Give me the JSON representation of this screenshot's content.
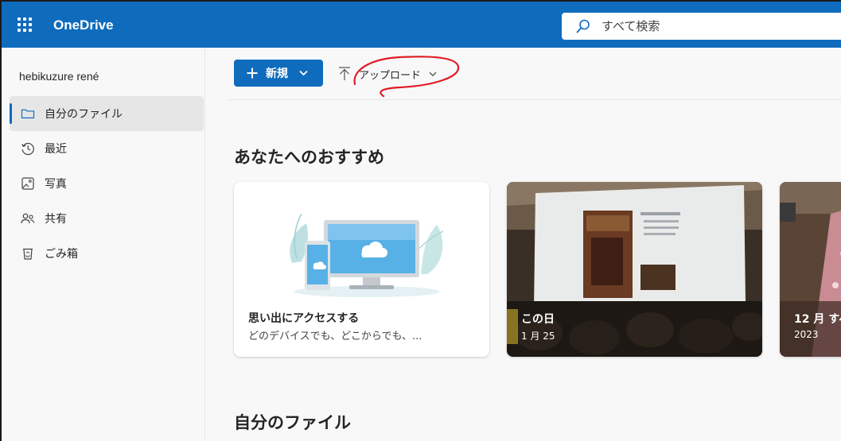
{
  "app": {
    "title": "OneDrive",
    "accent": "#0f6cbd"
  },
  "search": {
    "placeholder": "すべて検索"
  },
  "sidebar": {
    "user": "hebikuzure rené",
    "items": [
      {
        "label": "自分のファイル",
        "icon": "folder-icon",
        "active": true
      },
      {
        "label": "最近",
        "icon": "history-icon",
        "active": false
      },
      {
        "label": "写真",
        "icon": "image-icon",
        "active": false
      },
      {
        "label": "共有",
        "icon": "people-icon",
        "active": false
      },
      {
        "label": "ごみ箱",
        "icon": "recycle-bin-icon",
        "active": false
      }
    ]
  },
  "toolbar": {
    "new_label": "新規",
    "upload_label": "アップロード"
  },
  "recommend": {
    "title": "あなたへのおすすめ",
    "cards": [
      {
        "title": "思い出にアクセスする",
        "subtitle": "どのデバイスでも、どこからでも、..."
      },
      {
        "title": "この日",
        "date": "1 月 25"
      },
      {
        "title": "12 月 すべ",
        "date": "2023"
      }
    ]
  },
  "files": {
    "title": "自分のファイル"
  }
}
